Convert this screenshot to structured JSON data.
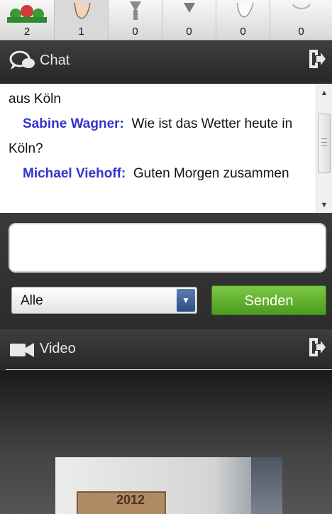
{
  "reactions": [
    {
      "icon": "group-icon",
      "count": "2"
    },
    {
      "icon": "raise-hand-icon",
      "count": "1"
    },
    {
      "icon": "person-icon",
      "count": "0"
    },
    {
      "icon": "thumbs-down-icon",
      "count": "0"
    },
    {
      "icon": "thumbs-up-icon",
      "count": "0"
    },
    {
      "icon": "smiley-icon",
      "count": "0"
    }
  ],
  "chat": {
    "title": "Chat",
    "messages": [
      {
        "author": "",
        "text": "aus Köln"
      },
      {
        "author": "Sabine Wagner:",
        "text": "Wie ist das Wetter heute in Köln?"
      },
      {
        "author": "Michael Viehoff:",
        "text": "Guten Morgen zusammen"
      }
    ],
    "input_placeholder": "",
    "recipient": "Alle",
    "send_label": "Senden"
  },
  "video": {
    "title": "Video",
    "thumb_text": "2012"
  },
  "colors": {
    "author": "#3333cc",
    "send_button": "#5aad2a",
    "header_bg": "#333333"
  }
}
